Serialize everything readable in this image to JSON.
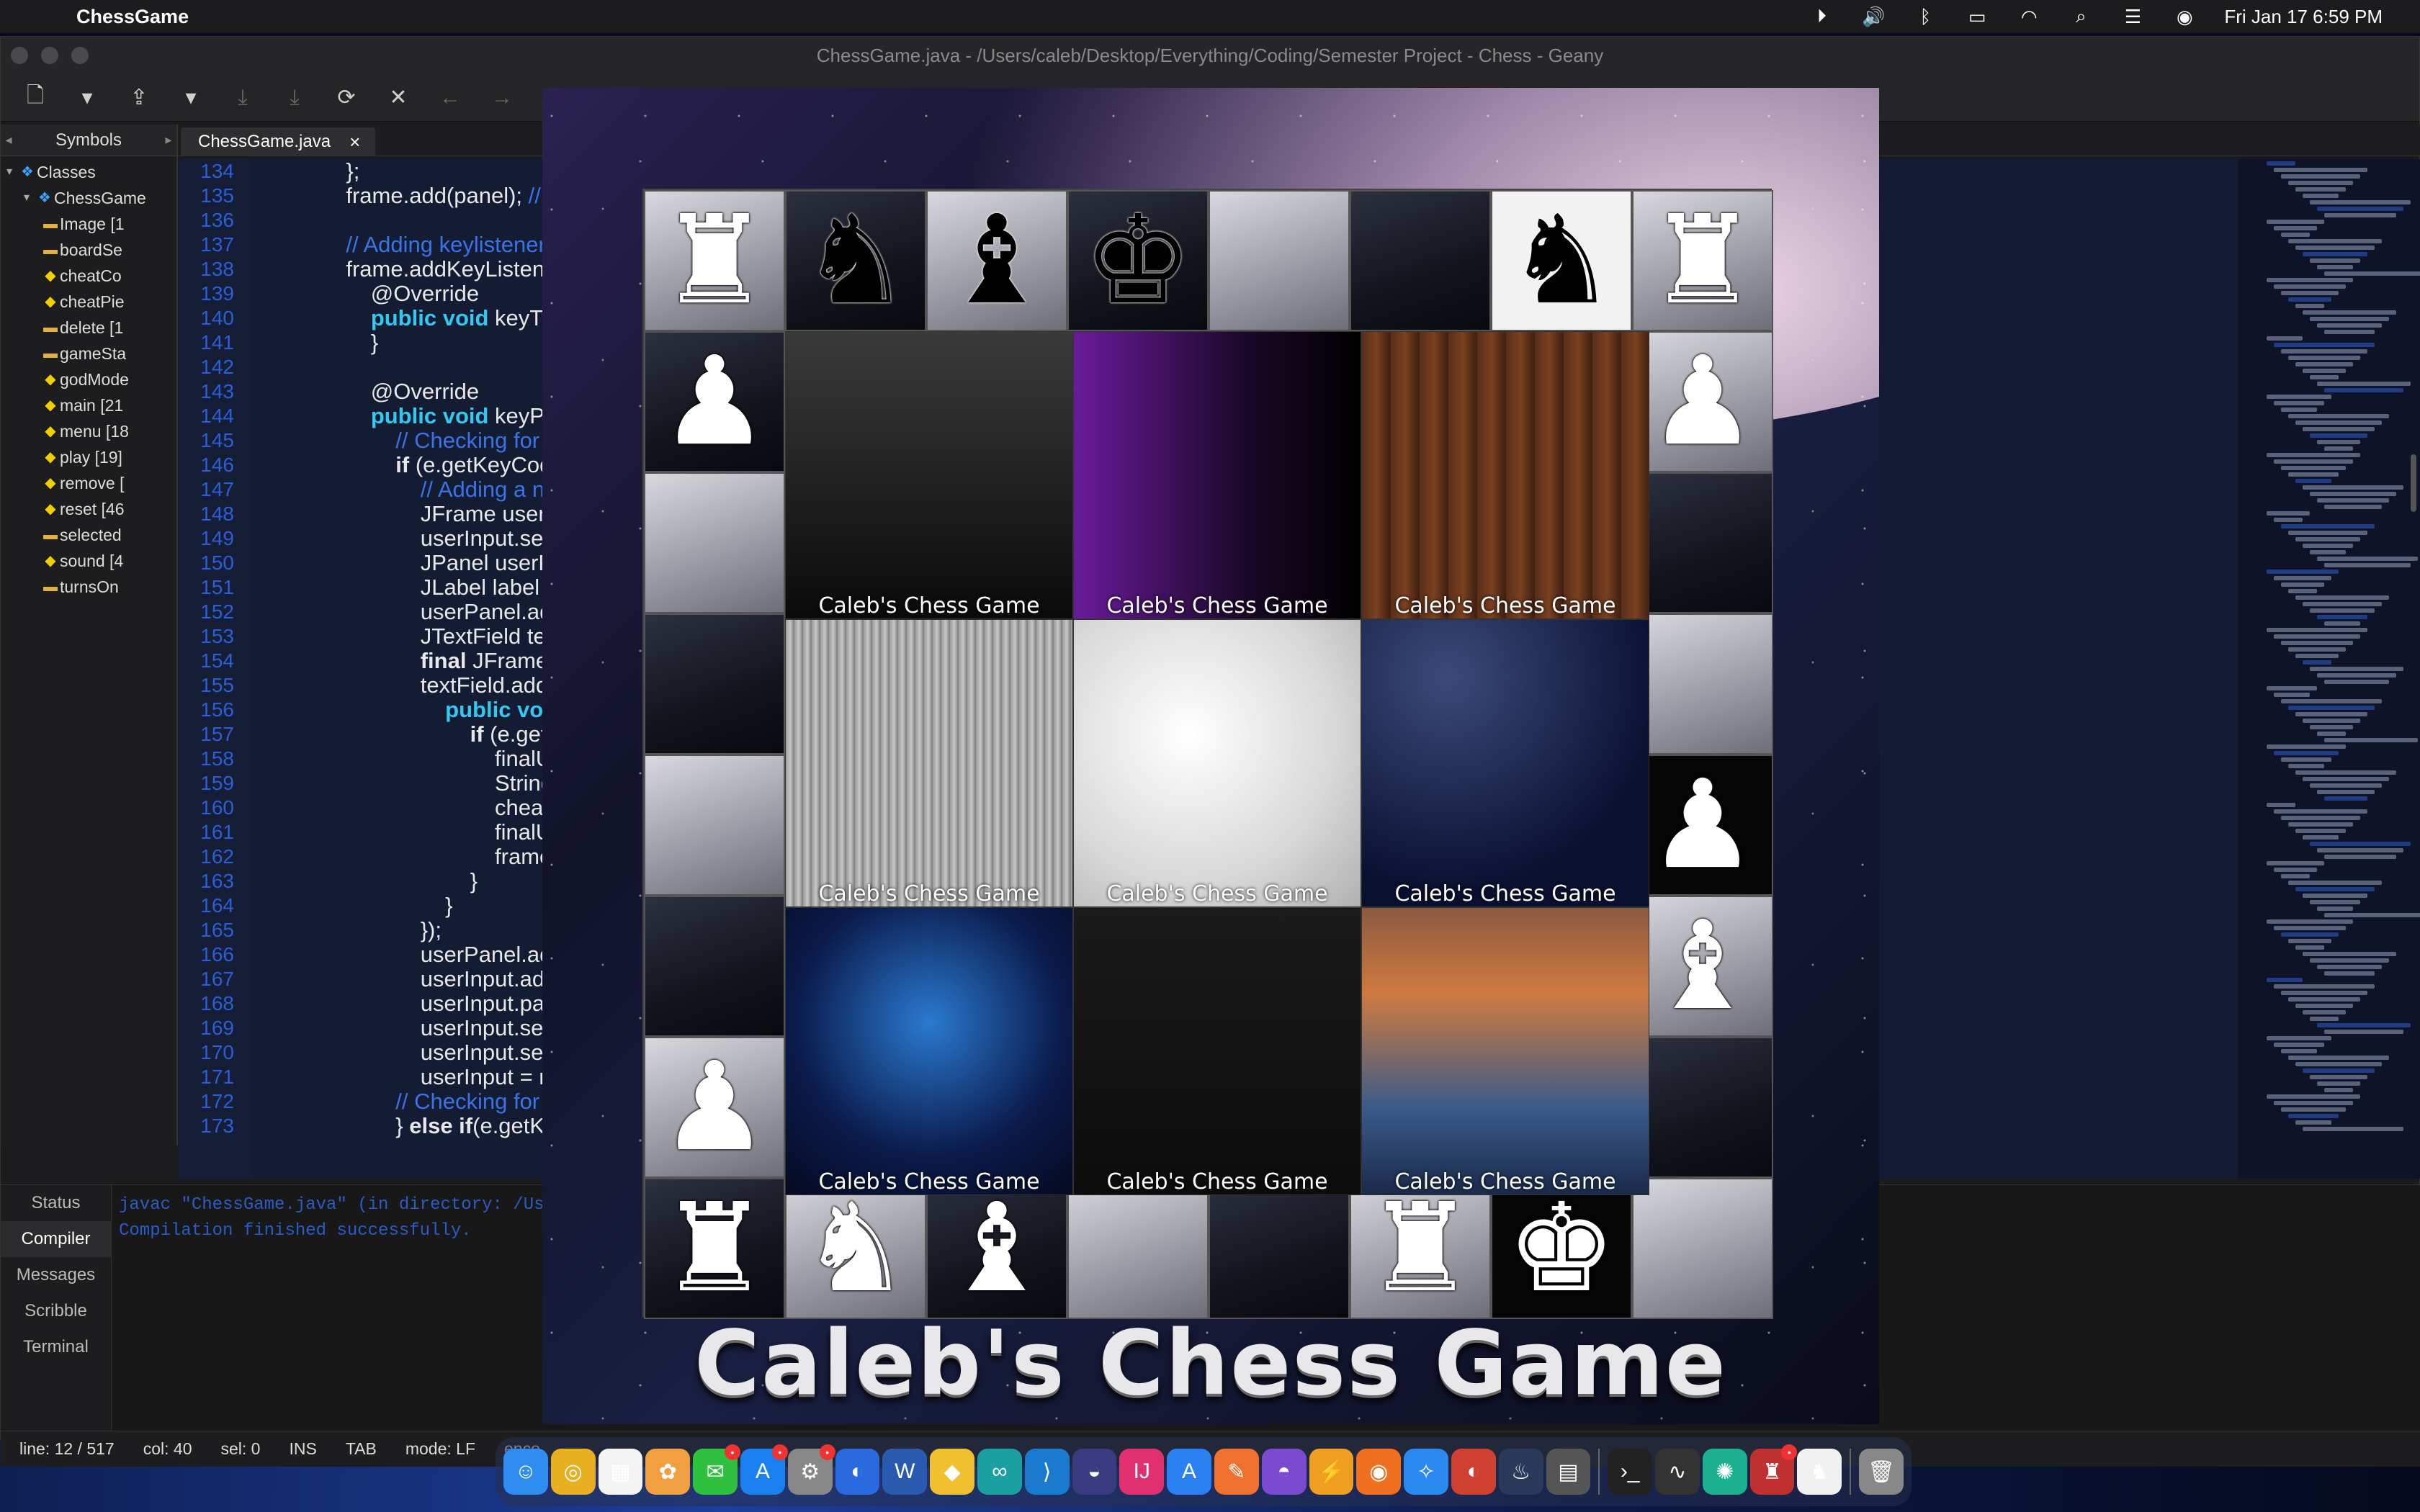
{
  "menubar": {
    "app_name": "ChessGame",
    "datetime": "Fri Jan 17  6:59 PM"
  },
  "window": {
    "title": "ChessGame.java - /Users/caleb/Desktop/Everything/Coding/Semester Project - Chess - Geany"
  },
  "sidebar": {
    "tab_label": "Symbols",
    "root_label": "Classes",
    "class_label": "ChessGame",
    "items": [
      {
        "label": "Image [1"
      },
      {
        "label": "boardSe"
      },
      {
        "label": "cheatCo"
      },
      {
        "label": "cheatPie"
      },
      {
        "label": "delete [1"
      },
      {
        "label": "gameSta"
      },
      {
        "label": "godMode"
      },
      {
        "label": "main [21"
      },
      {
        "label": "menu [18"
      },
      {
        "label": "play [19]"
      },
      {
        "label": "remove ["
      },
      {
        "label": "reset [46"
      },
      {
        "label": "selected"
      },
      {
        "label": "sound [4"
      },
      {
        "label": "turnsOn"
      }
    ]
  },
  "editor": {
    "tab_label": "ChessGame.java",
    "line_numbers": [
      "134",
      "135",
      "136",
      "137",
      "138",
      "139",
      "140",
      "141",
      "142",
      "143",
      "144",
      "145",
      "146",
      "147",
      "148",
      "149",
      "150",
      "151",
      "152",
      "153",
      "154",
      "155",
      "156",
      "157",
      "158",
      "159",
      "160",
      "161",
      "162",
      "163",
      "164",
      "165",
      "166",
      "167",
      "168",
      "169",
      "170",
      "171",
      "172",
      "173"
    ]
  },
  "messages": {
    "tabs": [
      "Status",
      "Compiler",
      "Messages",
      "Scribble",
      "Terminal"
    ],
    "active_tab": "Compiler",
    "lines": [
      "javac \"ChessGame.java\" (in directory: /Use",
      "Compilation finished successfully."
    ]
  },
  "statusbar": {
    "line": "line: 12 / 517",
    "col": "col: 40",
    "sel": "sel: 0",
    "ins": "INS",
    "tab": "TAB",
    "mode": "mode: LF",
    "encoding": "enco"
  },
  "chess": {
    "title": "Caleb's Chess Game",
    "caption": "Caleb's Chess Game",
    "theme_names": [
      "black",
      "purple",
      "wood",
      "metal",
      "marble",
      "space",
      "brain",
      "code",
      "fantasy"
    ]
  },
  "colors": {
    "keyword": "#34c7ef",
    "comment": "#3a73e6",
    "line_number": "#2a5fd8"
  }
}
